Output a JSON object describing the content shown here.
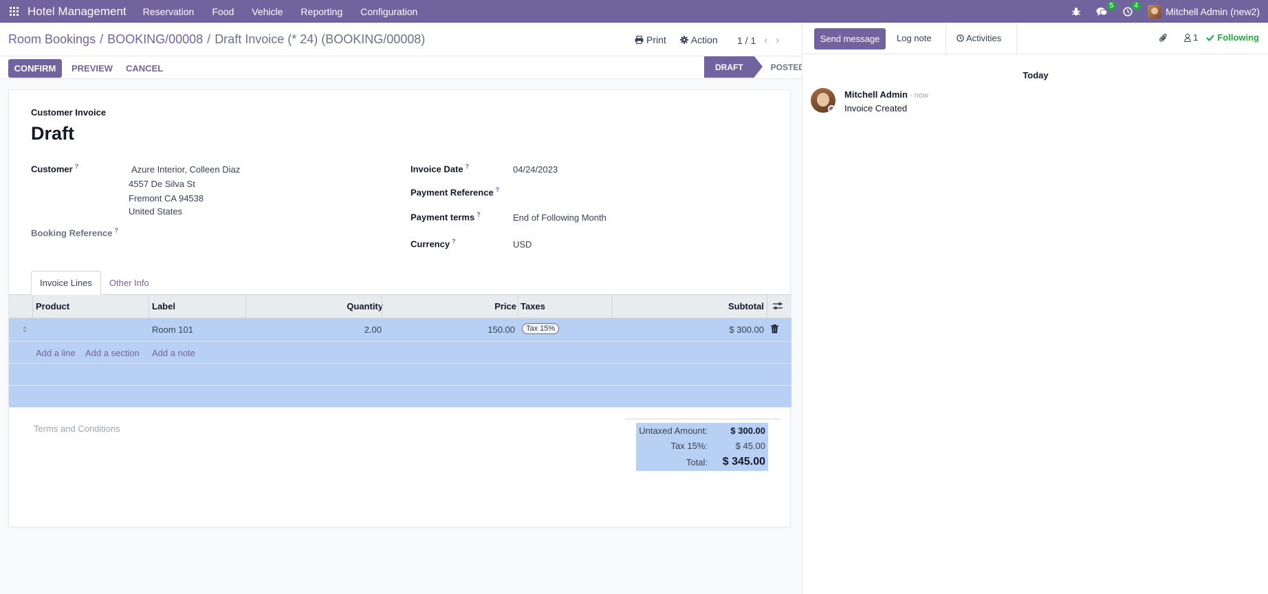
{
  "navbar": {
    "brand": "Hotel Management",
    "menu": [
      "Reservation",
      "Food",
      "Vehicle",
      "Reporting",
      "Configuration"
    ],
    "messages_count": "5",
    "activities_count": "4",
    "user": "Mitchell Admin (new2)"
  },
  "breadcrumb": {
    "root": "Room Bookings",
    "booking": "BOOKING/00008",
    "current": "Draft Invoice (* 24) (BOOKING/00008)"
  },
  "control": {
    "print": "Print",
    "action": "Action",
    "pager": "1 / 1",
    "confirm": "CONFIRM",
    "preview": "PREVIEW",
    "cancel": "CANCEL",
    "status_draft": "DRAFT",
    "status_posted": "POSTED"
  },
  "invoice": {
    "subtitle": "Customer Invoice",
    "title": "Draft",
    "customer_label": "Customer",
    "customer_name": "Azure Interior, Colleen Diaz",
    "address_1": "4557 De Silva St",
    "address_2": "Fremont CA 94538",
    "address_3": "United States",
    "booking_ref_label": "Booking Reference",
    "invoice_date_label": "Invoice Date",
    "invoice_date": "04/24/2023",
    "payment_ref_label": "Payment Reference",
    "payment_terms_label": "Payment terms",
    "payment_terms": "End of Following Month",
    "currency_label": "Currency",
    "currency": "USD",
    "help_mark": "?"
  },
  "tabs": [
    "Invoice Lines",
    "Other Info"
  ],
  "lines": {
    "columns": {
      "product": "Product",
      "label": "Label",
      "quantity": "Quantity",
      "price": "Price",
      "taxes": "Taxes",
      "subtotal": "Subtotal"
    },
    "rows": [
      {
        "product": "",
        "label": "Room 101",
        "quantity": "2.00",
        "price": "150.00",
        "tax": "Tax 15%",
        "subtotal": "$ 300.00"
      }
    ],
    "add_line": "Add a line",
    "add_section": "Add a section",
    "add_note": "Add a note"
  },
  "terms_placeholder": "Terms and Conditions",
  "totals": {
    "untaxed_label": "Untaxed Amount:",
    "untaxed": "$ 300.00",
    "tax_label": "Tax 15%:",
    "tax": "$ 45.00",
    "total_label": "Total:",
    "total": "$ 345.00"
  },
  "chatter": {
    "send_message": "Send message",
    "log_note": "Log note",
    "activities": "Activities",
    "followers_count": "1",
    "following": "Following",
    "today": "Today",
    "message": {
      "author": "Mitchell Admin",
      "time": " - now",
      "body": "Invoice Created"
    }
  },
  "colors": {
    "primary": "#71639e",
    "selection": "#b9d0f5",
    "success": "#28a745"
  }
}
